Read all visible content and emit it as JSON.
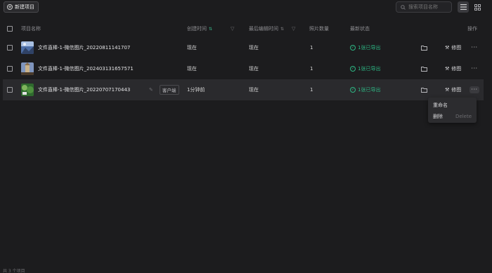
{
  "toolbar": {
    "new_project_label": "新建项目",
    "search_placeholder": "搜索项目名称"
  },
  "table": {
    "columns": {
      "name": "项目名称",
      "created": "创建时间",
      "edited": "最后编辑时间",
      "count": "照片数量",
      "status": "最新状态",
      "actions": "操作"
    },
    "rows": [
      {
        "name": "文件直棒-1-微信图片_20220811141707",
        "tag": "",
        "created": "现在",
        "edited": "现在",
        "count": "1",
        "status": "1张已导出",
        "retouch": "修图",
        "thumb_colors": [
          "#5a7bb0",
          "#c8d6e8",
          "#3a4a6a"
        ]
      },
      {
        "name": "文件直棒-1-微信图片_20240313165757​1",
        "tag": "",
        "created": "现在",
        "edited": "现在",
        "count": "1",
        "status": "1张已导出",
        "retouch": "修图",
        "thumb_colors": [
          "#7a8fb5",
          "#b89c74",
          "#4a3a2a"
        ]
      },
      {
        "name": "文件直棒-1-微信图片_20220707170443",
        "tag": "客户端",
        "created": "1分钟前",
        "edited": "现在",
        "count": "1",
        "status": "1张已导出",
        "retouch": "修图",
        "thumb_colors": [
          "#3c7a3a",
          "#8dbf6a",
          "#2a4a22"
        ]
      }
    ]
  },
  "context_menu": {
    "rename": "重命名",
    "delete": "删除",
    "delete_hint": "Delete"
  },
  "footer": {
    "count_text": "共 3 个项目"
  },
  "colors": {
    "background": "#1c1c1e",
    "accent_green": "#2db784",
    "hover_row": "#2a2a2d"
  }
}
